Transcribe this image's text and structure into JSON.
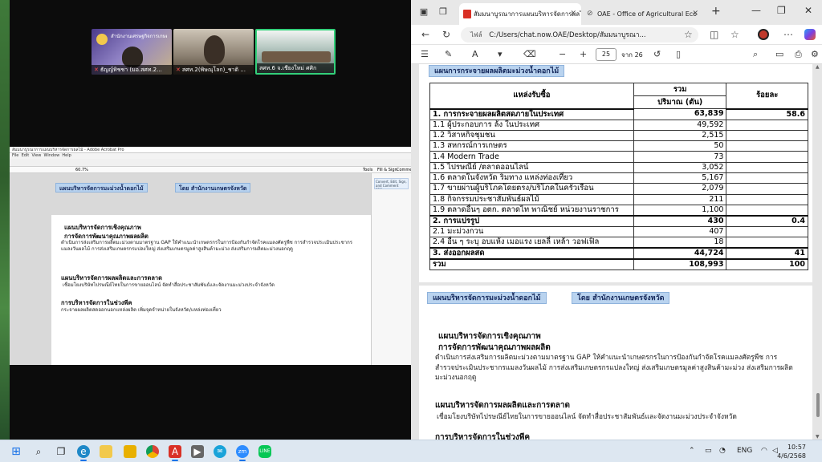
{
  "zoom": {
    "participants": [
      {
        "name": "ธัญญ์ทิชชา (มอ.สศท.2...",
        "muted": true,
        "org": "สำนักงานเศรษฐกิจการเกษตรที่ 2 พิษณุโลก"
      },
      {
        "name": "สศท.2(พิษณุโลก)_ชาติ ...",
        "muted": true
      },
      {
        "name": "สศท.6 จ.เชียงใหม่ ศศิก",
        "muted": false
      }
    ],
    "shared_window_title": "สัมมนาบูรณาการแผนบริหารจัดการผลไม้ - Adobe Acrobat Pro",
    "shared_menu": [
      "File",
      "Edit",
      "View",
      "Window",
      "Help"
    ],
    "shared_sidecard": "Convert, Edit, Sign, and Comment PDFs across your devices",
    "shared_toolbar": {
      "tools": "Tools",
      "fill_sign": "Fill & Sign",
      "comment": "Comment",
      "zoom": "60.7%"
    }
  },
  "browser": {
    "tabs": [
      {
        "title": "สัมมนาบูรณาการแผนบริหารจัดการผลไม้",
        "active": true
      },
      {
        "title": "OAE - Office of Agricultural Eco",
        "active": false
      }
    ],
    "url_label": "ไฟล์",
    "url": "C:/Users/chat.now.OAE/Desktop/สัมมนาบูรณา...",
    "page_current": "25",
    "page_total": "จาก 26"
  },
  "slide1": {
    "title": "แผนการกระจายผลผลิตมะม่วงน้ำดอกไม้",
    "header_source": "แหล่งรับซื้อ",
    "header_total": "รวม",
    "header_qty": "ปริมาณ (ตัน)",
    "header_pct": "ร้อยละ",
    "rows": [
      {
        "label": "1. การกระจายผลผลิตสดภายในประเทศ",
        "qty": "63,839",
        "pct": "58.6",
        "bold": true
      },
      {
        "label": "1.1 ผู้ประกอบการ ล้ง ในประเทศ",
        "qty": "49,592",
        "pct": "",
        "bold": false
      },
      {
        "label": "1.2 วิสาหกิจชุมชน",
        "qty": "2,515",
        "pct": "",
        "bold": false
      },
      {
        "label": "1.3 สหกรณ์การเกษตร",
        "qty": "50",
        "pct": "",
        "bold": false
      },
      {
        "label": "1.4 Modern Trade",
        "qty": "73",
        "pct": "",
        "bold": false
      },
      {
        "label": "1.5 ไปรษณีย์ /ตลาดออนไลน์",
        "qty": "3,052",
        "pct": "",
        "bold": false
      },
      {
        "label": "1.6 ตลาดในจังหวัด ริมทาง แหล่งท่องเที่ยว",
        "qty": "5,167",
        "pct": "",
        "bold": false
      },
      {
        "label": "1.7 ขายผ่านผู้บริโภคโดยตรง/บริโภคในครัวเรือน",
        "qty": "2,079",
        "pct": "",
        "bold": false
      },
      {
        "label": "1.8 กิจกรรมประชาสัมพันธ์ผลไม้",
        "qty": "211",
        "pct": "",
        "bold": false
      },
      {
        "label": "1.9 ตลาดอื่นๆ อตก. ตลาดไท พาณิชย์ หน่วยงานราชการ",
        "qty": "1,100",
        "pct": "",
        "bold": false
      },
      {
        "label": "2. การแปรรูป",
        "qty": "430",
        "pct": "0.4",
        "bold": true
      },
      {
        "label": "2.1 มะม่วงกวน",
        "qty": "407",
        "pct": "",
        "bold": false
      },
      {
        "label": "2.4 อื่น ๆ ระบุ อบแห้ง เมอแรง เยลลี่ เหล้า วอฟเฟิล",
        "qty": "18",
        "pct": "",
        "bold": false
      },
      {
        "label": "3. ส่งออกผลสด",
        "qty": "44,724",
        "pct": "41",
        "bold": true
      },
      {
        "label": "รวม",
        "qty": "108,993",
        "pct": "100",
        "bold": true
      }
    ]
  },
  "slide2": {
    "pill_left": "แผนบริหารจัดการมะม่วงน้ำดอกไม้",
    "pill_right": "โดย สำนักงานเกษตรจังหวัด",
    "h1": "แผนบริหารจัดการเชิงคุณภาพ",
    "h1b": "การจัดการพัฒนาคุณภาพผลผลิต",
    "p1": "ดำเนินการส่งเสริมการผลิตมะม่วงตามมาตรฐาน GAP ให้คำแนะนำเกษตรกรในการป้องกันกำจัดโรคแมลงศัตรูพืช การสำรวจประเมินประชากรแมลงวันผลไม้ การส่งเสริมเกษตรกรแปลงใหญ่ ส่งเสริมเกษตรมูลค่าสูงสินค้ามะม่วง ส่งเสริมการผลิตมะม่วงนอกฤดู",
    "h2": "แผนบริหารจัดการผลผลิตและการตลาด",
    "p2": "เชื่อมโยงบริษัทไปรษณีย์ไทยในการขายออนไลน์  จัดทำสื่อประชาสัมพันธ์และจัดงานมะม่วงประจำจังหวัด",
    "h3": "การบริหารจัดการในช่วงพีค",
    "p3": "กระจายผลผลิตสดออกนอกแหล่งผลิต เพิ่มจุดจำหน่ายในจังหวัด/แหล่งท่องเที่ยว"
  },
  "taskbar": {
    "lang": "ENG",
    "time": "10:57",
    "date": "4/6/2568",
    "apps": [
      "start",
      "search",
      "task-view",
      "edge",
      "file-explorer",
      "chrome",
      "acrobat",
      "media",
      "zoom",
      "line"
    ]
  }
}
